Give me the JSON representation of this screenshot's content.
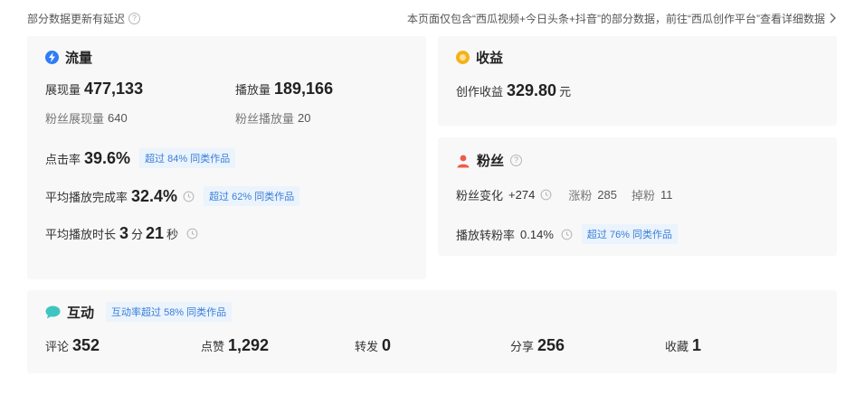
{
  "top": {
    "notice": "部分数据更新有延迟",
    "description": "本页面仅包含“西瓜视频+今日头条+抖音”的部分数据，前往“西瓜创作平台”查看详细数据"
  },
  "traffic": {
    "title": "流量",
    "impressions_label": "展现量",
    "impressions_value": "477,133",
    "plays_label": "播放量",
    "plays_value": "189,166",
    "fan_impressions_label": "粉丝展现量",
    "fan_impressions_value": "640",
    "fan_plays_label": "粉丝播放量",
    "fan_plays_value": "20",
    "ctr_label": "点击率",
    "ctr_value": "39.6%",
    "ctr_badge": "超过 84% 同类作品",
    "completion_label": "平均播放完成率",
    "completion_value": "32.4%",
    "completion_badge": "超过 62% 同类作品",
    "duration_label": "平均播放时长",
    "duration_min": "3",
    "duration_min_unit": "分",
    "duration_sec": "21",
    "duration_sec_unit": "秒"
  },
  "earnings": {
    "title": "收益",
    "label": "创作收益",
    "value": "329.80",
    "unit": "元"
  },
  "fans": {
    "title": "粉丝",
    "change_label": "粉丝变化",
    "change_value": "+274",
    "gain_label": "涨粉",
    "gain_value": "285",
    "loss_label": "掉粉",
    "loss_value": "11",
    "conversion_label": "播放转粉率",
    "conversion_value": "0.14%",
    "conversion_badge": "超过 76% 同类作品"
  },
  "interaction": {
    "title": "互动",
    "badge": "互动率超过 58% 同类作品",
    "comments_label": "评论",
    "comments_value": "352",
    "likes_label": "点赞",
    "likes_value": "1,292",
    "reposts_label": "转发",
    "reposts_value": "0",
    "shares_label": "分享",
    "shares_value": "256",
    "favorites_label": "收藏",
    "favorites_value": "1"
  },
  "icons": {
    "traffic": "blue-lightning-icon",
    "earnings": "gold-coin-icon",
    "fans": "red-person-icon",
    "interaction": "teal-chat-bubble-icon",
    "help": "question-circle-icon",
    "history": "clock-history-icon",
    "chevron": "chevron-right-icon"
  },
  "colors": {
    "traffic_icon": "#2f7df6",
    "earnings_icon": "#f5b21c",
    "fans_icon": "#ef5b4b",
    "interaction_icon": "#3fc5c0",
    "badge_bg": "#ebf3fd",
    "badge_text": "#3a7fd6"
  }
}
